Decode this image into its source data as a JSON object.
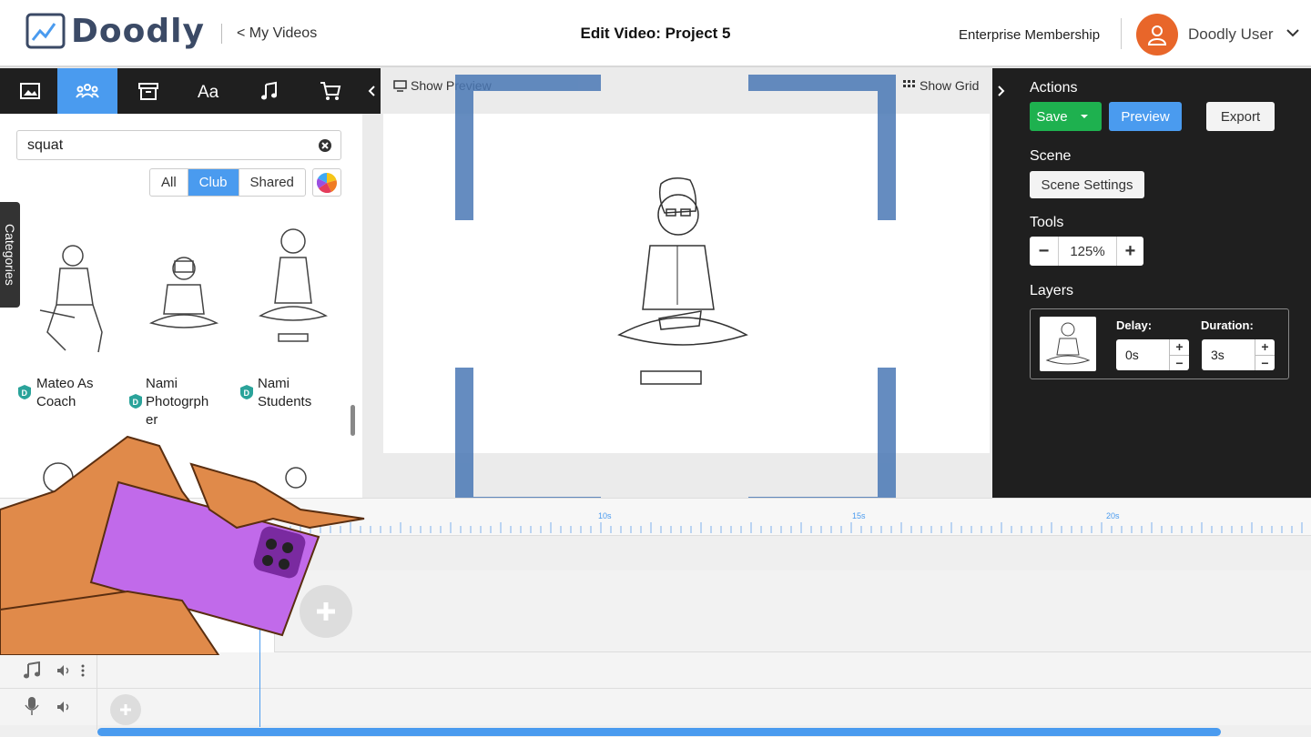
{
  "header": {
    "logo_text": "Doodly",
    "back_link": "< My Videos",
    "title": "Edit Video: Project 5",
    "membership": "Enterprise Membership",
    "user_name": "Doodly User"
  },
  "left_tabs": [
    {
      "name": "images-tab",
      "icon": "image-icon"
    },
    {
      "name": "characters-tab",
      "icon": "people-icon",
      "active": true
    },
    {
      "name": "props-tab",
      "icon": "box-icon"
    },
    {
      "name": "text-tab",
      "icon": "text-icon"
    },
    {
      "name": "music-tab",
      "icon": "music-note-icon"
    },
    {
      "name": "store-tab",
      "icon": "cart-icon"
    }
  ],
  "search": {
    "value": "squat"
  },
  "filters": {
    "all": "All",
    "club": "Club",
    "shared": "Shared",
    "active": "Club"
  },
  "categories_label": "Categories",
  "assets": [
    {
      "label_l1": "Mateo As",
      "label_l2": "Coach",
      "label_l3": ""
    },
    {
      "label_l1": "Nami",
      "label_l2": "Photogrph",
      "label_l3": "er"
    },
    {
      "label_l1": "Nami",
      "label_l2": "Students",
      "label_l3": ""
    }
  ],
  "canvas": {
    "show_preview": "Show Preview",
    "show_grid": "Show Grid"
  },
  "right_panel": {
    "actions_label": "Actions",
    "save_label": "Save",
    "preview_label": "Preview",
    "export_label": "Export",
    "scene_label": "Scene",
    "scene_settings_label": "Scene Settings",
    "tools_label": "Tools",
    "zoom_value": "125%",
    "layers_label": "Layers",
    "delay_label": "Delay:",
    "delay_value": "0s",
    "duration_label": "Duration:",
    "duration_value": "3s"
  },
  "timeline": {
    "ticks": [
      "10s",
      "15s",
      "20s"
    ]
  },
  "colors": {
    "accent": "#4a9bef",
    "save": "#1eb14f",
    "avatar": "#e8662a",
    "dark": "#1f1f1f"
  }
}
